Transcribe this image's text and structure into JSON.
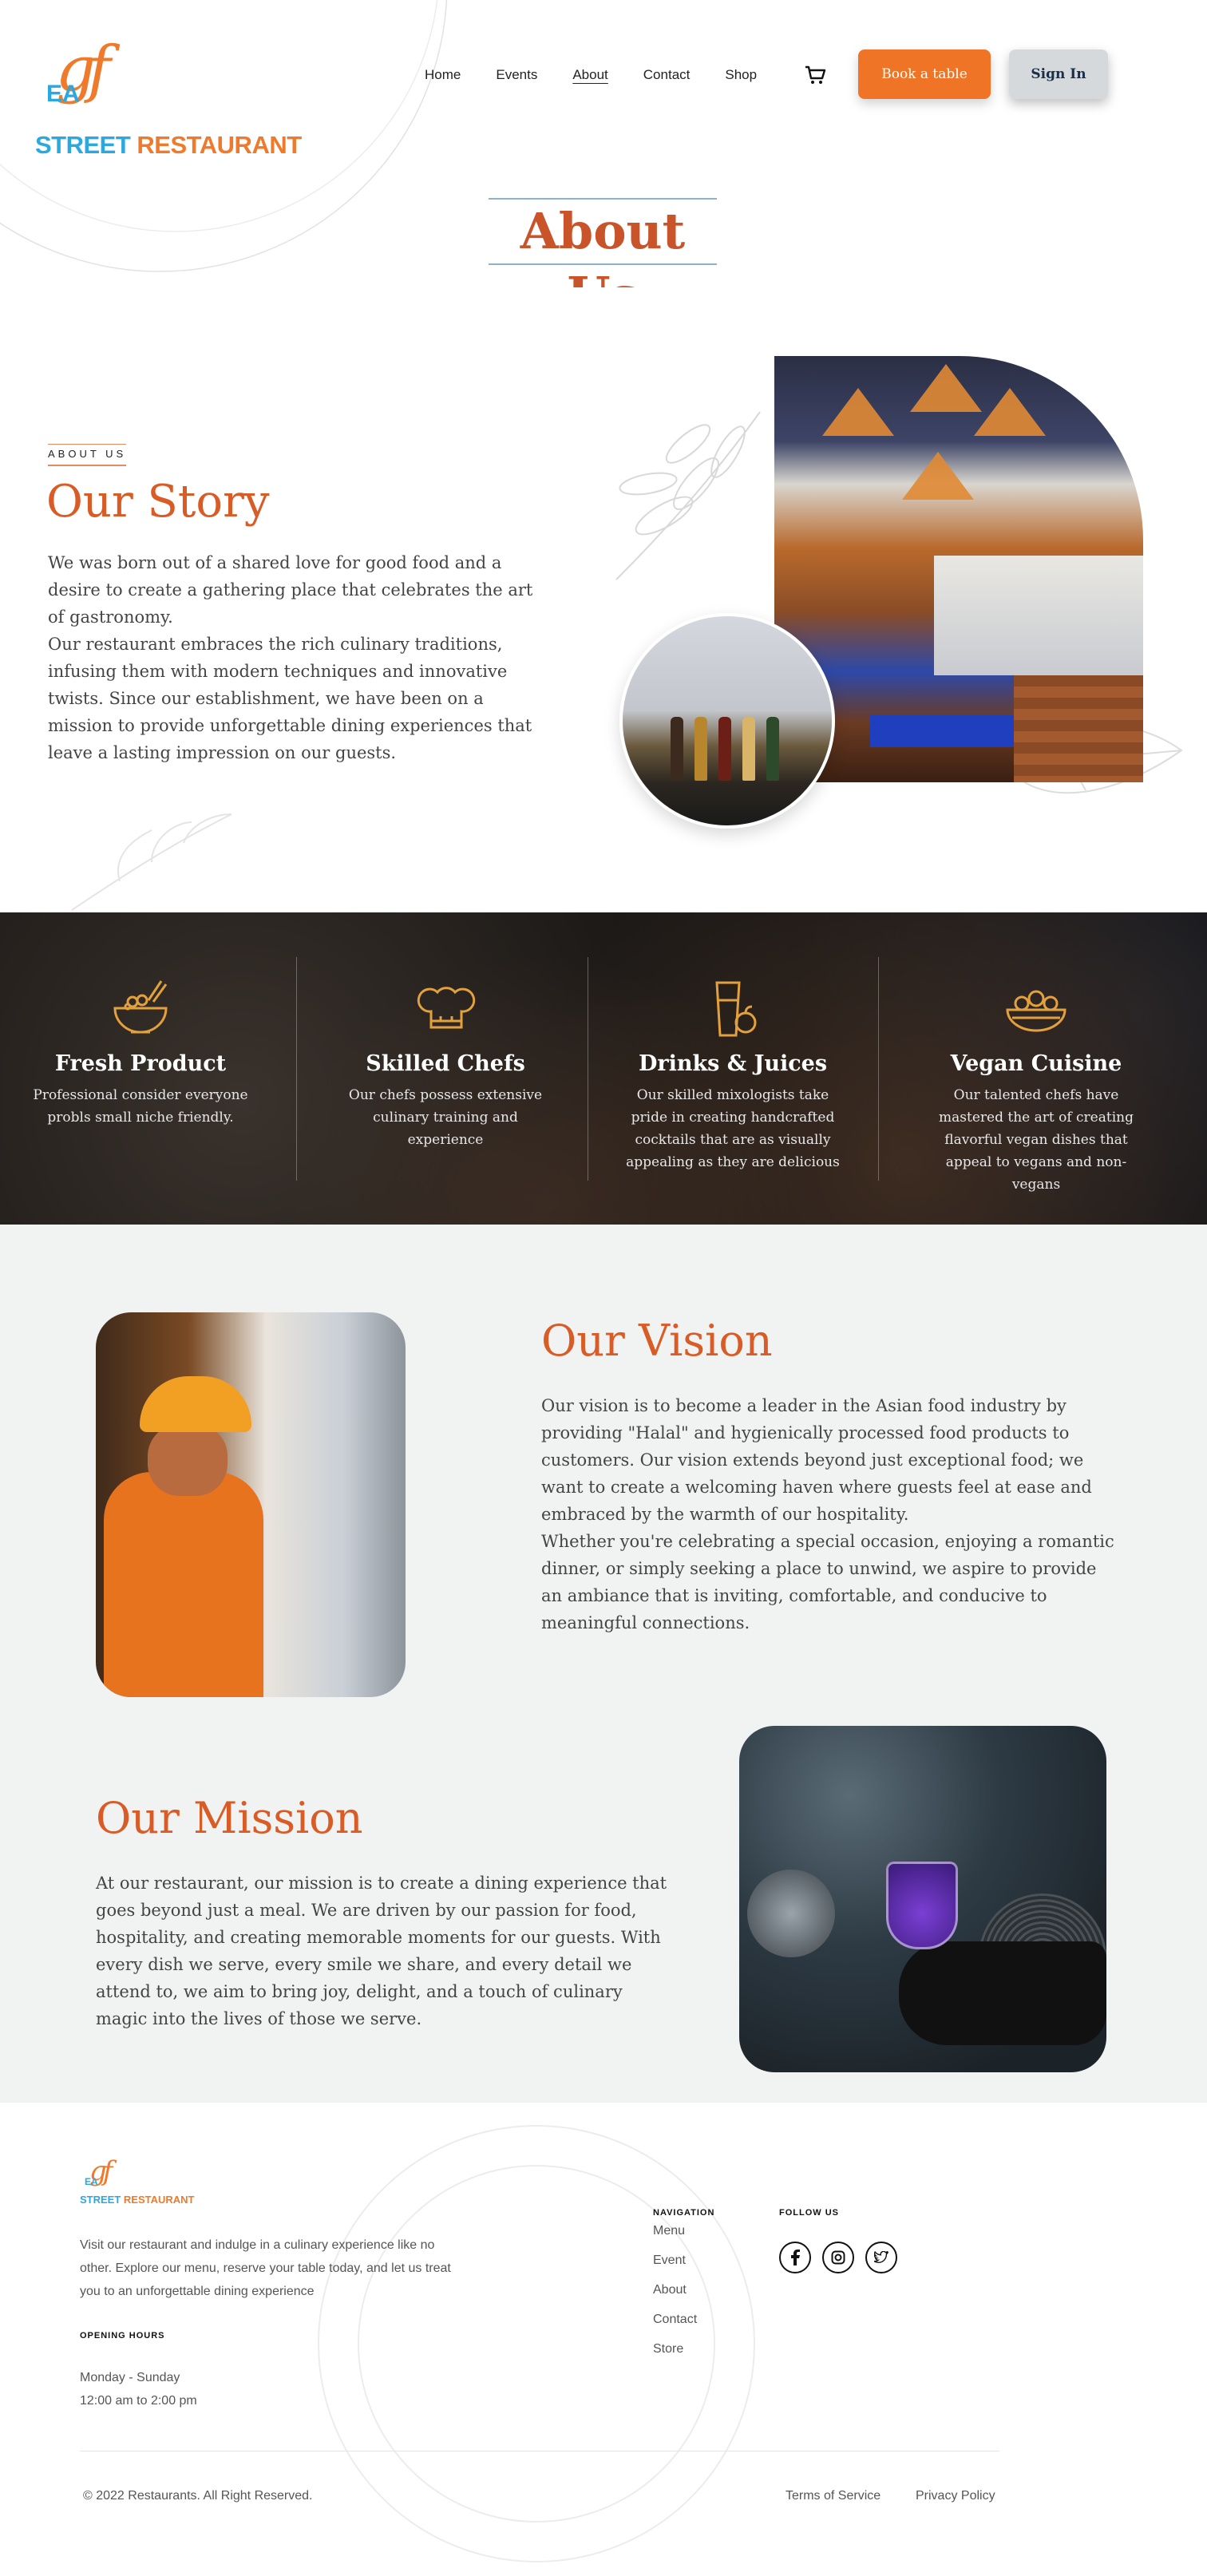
{
  "brand": {
    "logo_top": "gf",
    "logo_mid": "EA",
    "logo_street": "STREET",
    "logo_restaurant": " RESTAURANT",
    "colors": {
      "orange": "#ef7426",
      "blue": "#2aa8e0",
      "heading": "#d95b26"
    }
  },
  "nav": {
    "items": [
      "Home",
      "Events",
      "About",
      "Contact",
      "Shop"
    ],
    "active": "About",
    "cart_icon": "cart-icon",
    "book_label": "Book a table",
    "sign_label": "Sign In"
  },
  "page_title": "About Us",
  "story": {
    "eyebrow": "ABOUT US",
    "title": "Our Story",
    "body": "We was born out of a shared love for good food and a desire to create a gathering place that celebrates the art of gastronomy.\nOur restaurant embraces the rich culinary traditions, infusing them with modern techniques and innovative twists. Since our establishment, we have been on a mission to provide unforgettable dining experiences that leave a lasting impression on our guests."
  },
  "features": [
    {
      "icon": "rice-bowl-icon",
      "title": "Fresh Product",
      "text": "Professional consider everyone\nprobls small niche friendly."
    },
    {
      "icon": "chef-hat-icon",
      "title": "Skilled Chefs",
      "text": "Our chefs possess extensive culinary training and experience"
    },
    {
      "icon": "juice-icon",
      "title": "Drinks & Juices",
      "text": "Our skilled mixologists take pride in creating handcrafted cocktails that are as visually appealing as they are delicious"
    },
    {
      "icon": "salad-bowl-icon",
      "title": "Vegan Cuisine",
      "text": "Our talented chefs have mastered the art of creating flavorful vegan dishes that appeal to vegans and non-vegans"
    }
  ],
  "vision": {
    "title": "Our Vision",
    "body": "Our vision is to become a leader in the Asian food industry by providing \"Halal\" and hygienically processed food products to customers. Our vision extends beyond just exceptional food; we want to create a welcoming haven where guests feel at ease and embraced by the warmth of our hospitality.\nWhether you're celebrating a special occasion, enjoying a romantic dinner, or simply seeking a place to unwind, we aspire to provide an ambiance that is inviting, comfortable, and conducive to meaningful connections."
  },
  "mission": {
    "title": "Our Mission",
    "body": "At our restaurant, our mission is to create a dining experience that goes beyond just a meal. We are driven by our passion for food, hospitality, and creating memorable moments for our guests. With every dish we serve, every smile we share, and every detail we attend to, we aim to bring joy, delight, and a touch of culinary magic into the lives of those we serve."
  },
  "footer": {
    "description": "Visit our restaurant and indulge in a culinary experience like no other. Explore our menu, reserve your table today, and let us treat you to an unforgettable dining experience",
    "hours_heading": "OPENING HOURS",
    "hours": "Monday - Sunday\n12:00 am to 2:00 pm",
    "nav_heading": "NAVIGATION",
    "nav_items": [
      "Menu",
      "Event",
      "About",
      "Contact",
      "Store"
    ],
    "follow_heading": "FOLLOW US",
    "social_icons": [
      "facebook-icon",
      "instagram-icon",
      "twitter-icon"
    ],
    "copyright": "©  2022 Restaurants. All Right Reserved.",
    "terms": "Terms of Service",
    "privacy": "Privacy Policy"
  }
}
